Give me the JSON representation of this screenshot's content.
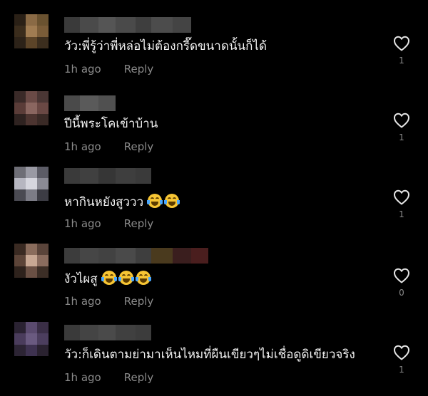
{
  "comments": [
    {
      "text": "วัว:พี่รู้ว่าพี่หล่อไม่ต้องกรี๊ดขนาดนั้นก็ได้",
      "time": "1h ago",
      "reply_label": "Reply",
      "likes": "1",
      "avatar_colors": [
        "#2a2016",
        "#8a6a45",
        "#6a5230",
        "#3a2c1c",
        "#a07c52",
        "#7a5c38",
        "#2c2218",
        "#5c4428",
        "#3c2e1e"
      ],
      "name_colors": [
        "#3a3a3a",
        "#4a4a4a",
        "#555555",
        "#4a4a4a",
        "#3e3e3e",
        "#4c4c4c",
        "#444444"
      ]
    },
    {
      "text": "ปีนี้พระโคเข้าบ้าน",
      "time": "1h ago",
      "reply_label": "Reply",
      "likes": "1",
      "avatar_colors": [
        "#3a2a28",
        "#6a4a46",
        "#4a3634",
        "#5a3c38",
        "#8a6660",
        "#6a4844",
        "#2e2220",
        "#4c3430",
        "#3a2a26"
      ],
      "name_colors": [
        "#4a4a4a",
        "#5a5a5a",
        "#505050"
      ]
    },
    {
      "text": "หากินหยังสูววว",
      "time": "1h ago",
      "reply_label": "Reply",
      "likes": "1",
      "emoji_count": 2,
      "avatar_colors": [
        "#6e6e76",
        "#9a9aa4",
        "#5c5c66",
        "#b6b6c0",
        "#d6d6de",
        "#8a8a94",
        "#4a4a52",
        "#7c7c86",
        "#3c3c44"
      ],
      "name_colors": [
        "#3a3a3a",
        "#404040",
        "#363636",
        "#3e3e3e",
        "#3a3a3a"
      ]
    },
    {
      "text": "งัวไผสู",
      "time": "1h ago",
      "reply_label": "Reply",
      "likes": "0",
      "emoji_count": 3,
      "avatar_colors": [
        "#3a2a22",
        "#8a6c5c",
        "#5a443a",
        "#5c4438",
        "#c8a894",
        "#8a6c5e",
        "#2e221c",
        "#6a5044",
        "#3c2e26"
      ],
      "name_colors": [
        "#3c3c3c",
        "#464646",
        "#424242",
        "#4a4a4a",
        "#3e3e3e",
        "#4a3a1e",
        "#3a1e1e",
        "#4a1e1e"
      ]
    },
    {
      "text": "วัว:ก็เดินตามย่ามาเห็นไหมที่ผืนเขียวๆไม่เชื่อดูดิเขียวจริง",
      "time": "1h ago",
      "reply_label": "Reply",
      "likes": "1",
      "avatar_colors": [
        "#2a2232",
        "#5a4a6e",
        "#3a2e46",
        "#4a3c5c",
        "#6a5a80",
        "#4c3e5e",
        "#2c2434",
        "#3e3250",
        "#2a2230"
      ],
      "name_colors": [
        "#3a3a3a",
        "#444444",
        "#4a4a4a",
        "#404040",
        "#3c3c3c"
      ]
    }
  ],
  "colors": {
    "background": "#000000",
    "text": "#f2f2f2",
    "meta": "#8a8a8a",
    "heart_outline": "#e6e6e6"
  },
  "icons": {
    "like": "heart-outline-icon",
    "emoji": "face-with-tears-of-joy-icon"
  }
}
